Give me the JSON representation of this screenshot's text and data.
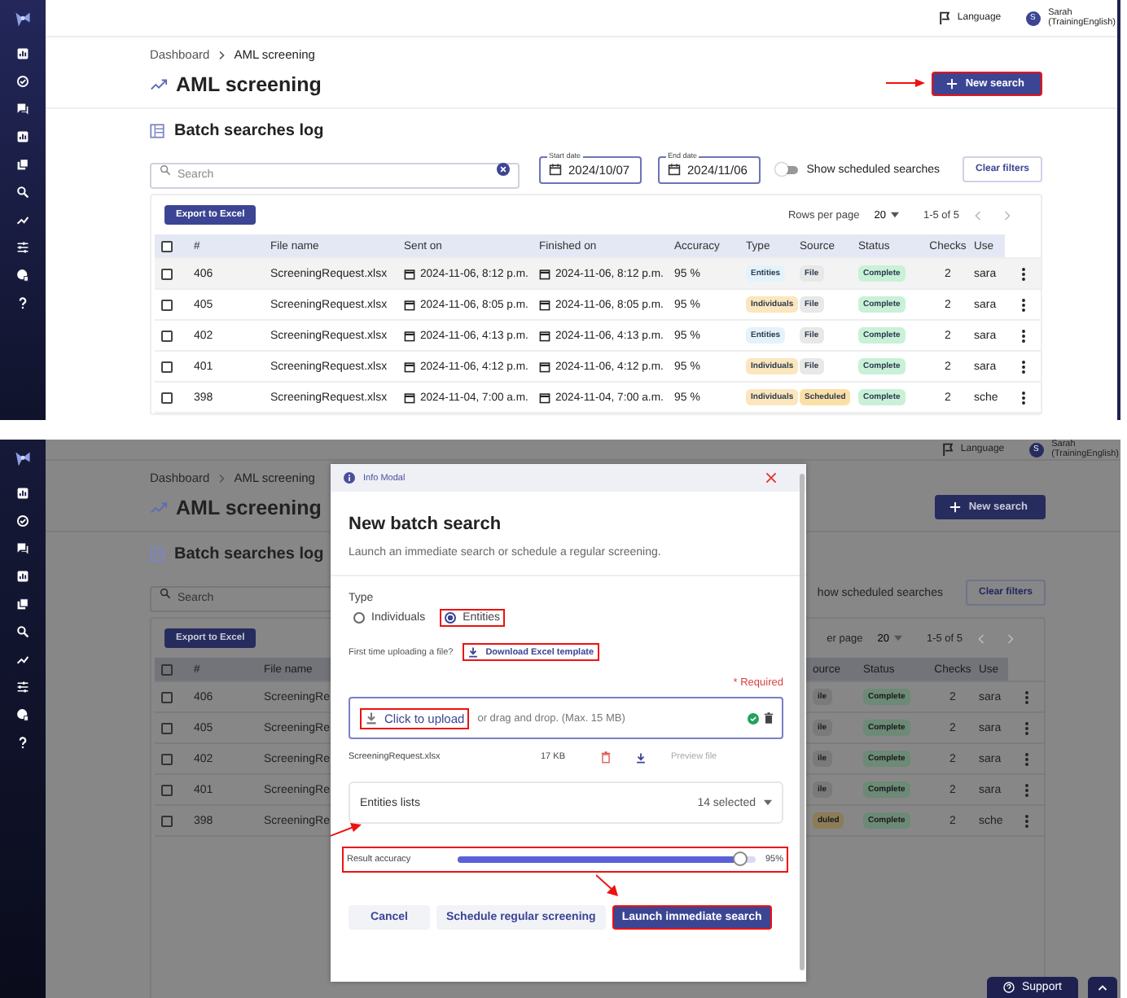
{
  "panels": [
    {
      "header": {
        "language": "Language",
        "avatar_initial": "S",
        "user_name": "Sarah",
        "user_detail": "(TrainingEnglish)"
      },
      "breadcrumb": [
        "Dashboard",
        "AML screening"
      ],
      "title": "AML screening",
      "new_search_button": {
        "label": "New search",
        "highlighted": true,
        "arrow": true
      },
      "section_title": "Batch searches log",
      "search": {
        "placeholder": "Search",
        "clearable": true
      },
      "start_date": {
        "label": "Start date",
        "value": "2024/10/07"
      },
      "end_date": {
        "label": "End date",
        "value": "2024/11/06"
      },
      "scheduled_toggle": {
        "label": "Show scheduled searches",
        "on": false
      },
      "clear_filters": "Clear filters",
      "export_button": "Export to Excel",
      "pagination": {
        "rows_per_page_label": "Rows per page",
        "rows_per_page": "20",
        "range": "1-5 of 5"
      },
      "table": {
        "columns": [
          {
            "kind": "select",
            "checked": false
          },
          {
            "kind": "number",
            "label": "#"
          },
          {
            "kind": "file",
            "label": "File name"
          },
          {
            "kind": "date",
            "label": "Sent on"
          },
          {
            "kind": "date",
            "label": "Finished on"
          },
          {
            "kind": "accuracy",
            "label": "Accuracy"
          },
          {
            "kind": "type",
            "label": "Type"
          },
          {
            "kind": "source",
            "label": "Source"
          },
          {
            "kind": "status",
            "label": "Status"
          },
          {
            "kind": "checks",
            "label": "Checks"
          },
          {
            "kind": "user",
            "label": "Use"
          }
        ],
        "rows": [
          {
            "hovered": true,
            "cells": [
              {
                "checked": false
              },
              "406",
              "ScreeningRequest.xlsx",
              "2024-11-06, 8:12 p.m.",
              "2024-11-06, 8:12 p.m.",
              "95 %",
              {
                "label": "Entities",
                "color": "#e4f3fb"
              },
              {
                "label": "File",
                "color": "#e8e8e8"
              },
              {
                "label": "Complete",
                "color": "#c8f1d8"
              },
              "2",
              "sara"
            ]
          },
          {
            "hovered": false,
            "cells": [
              {
                "checked": false
              },
              "405",
              "ScreeningRequest.xlsx",
              "2024-11-06, 8:05 p.m.",
              "2024-11-06, 8:05 p.m.",
              "95 %",
              {
                "label": "Individuals",
                "color": "#fbe6bd"
              },
              {
                "label": "File",
                "color": "#e8e8e8"
              },
              {
                "label": "Complete",
                "color": "#c8f1d8"
              },
              "2",
              "sara"
            ]
          },
          {
            "hovered": false,
            "cells": [
              {
                "checked": false
              },
              "402",
              "ScreeningRequest.xlsx",
              "2024-11-06, 4:13 p.m.",
              "2024-11-06, 4:13 p.m.",
              "95 %",
              {
                "label": "Entities",
                "color": "#e4f3fb"
              },
              {
                "label": "File",
                "color": "#e8e8e8"
              },
              {
                "label": "Complete",
                "color": "#c8f1d8"
              },
              "2",
              "sara"
            ]
          },
          {
            "hovered": false,
            "cells": [
              {
                "checked": false
              },
              "401",
              "ScreeningRequest.xlsx",
              "2024-11-06, 4:12 p.m.",
              "2024-11-06, 4:12 p.m.",
              "95 %",
              {
                "label": "Individuals",
                "color": "#fbe6bd"
              },
              {
                "label": "File",
                "color": "#e8e8e8"
              },
              {
                "label": "Complete",
                "color": "#c8f1d8"
              },
              "2",
              "sara"
            ]
          },
          {
            "hovered": false,
            "cells": [
              {
                "checked": false
              },
              "398",
              "ScreeningRequest.xlsx",
              "2024-11-04, 7:00 a.m.",
              "2024-11-04, 7:00 a.m.",
              "95 %",
              {
                "label": "Individuals",
                "color": "#fbe6bd"
              },
              {
                "label": "Scheduled",
                "color": "#fbe0a6"
              },
              {
                "label": "Complete",
                "color": "#c8f1d8"
              },
              "2",
              "sche"
            ]
          }
        ]
      }
    },
    {
      "header": {
        "language": "Language",
        "avatar_initial": "S",
        "user_name": "Sarah",
        "user_detail": "(TrainingEnglish)"
      },
      "breadcrumb": [
        "Dashboard",
        "AML screening"
      ],
      "title": "AML screening",
      "new_search_button": {
        "label": "New search",
        "highlighted": false
      },
      "section_title": "Batch searches log",
      "search": {
        "placeholder": "Search"
      },
      "scheduled_toggle": {
        "label": "how scheduled searches"
      },
      "clear_filters": "Clear filters",
      "export_button": "Export to Excel",
      "pagination": {
        "rows_per_page_label": "er page",
        "rows_per_page": "20",
        "range": "1-5 of 5"
      },
      "table": {
        "columns": [
          {
            "kind": "select",
            "checked": false
          },
          {
            "kind": "number",
            "label": "#"
          },
          {
            "kind": "file",
            "label": "File name"
          },
          {
            "kind": "covered"
          },
          {
            "kind": "source",
            "label": "ource"
          },
          {
            "kind": "status",
            "label": "Status"
          },
          {
            "kind": "checks",
            "label": "Checks"
          },
          {
            "kind": "user",
            "label": "Use"
          }
        ],
        "rows": [
          {
            "cells": [
              {
                "checked": false
              },
              "406",
              "ScreeningRe",
              null,
              {
                "label": "ile",
                "color": "#7a7a7a"
              },
              {
                "label": "Complete",
                "color": "#6c8a76"
              },
              "2",
              "sara"
            ]
          },
          {
            "cells": [
              {
                "checked": false
              },
              "405",
              "ScreeningRe",
              null,
              {
                "label": "ile",
                "color": "#7a7a7a"
              },
              {
                "label": "Complete",
                "color": "#6c8a76"
              },
              "2",
              "sara"
            ]
          },
          {
            "cells": [
              {
                "checked": false
              },
              "402",
              "ScreeningRe",
              null,
              {
                "label": "ile",
                "color": "#7a7a7a"
              },
              {
                "label": "Complete",
                "color": "#6c8a76"
              },
              "2",
              "sara"
            ]
          },
          {
            "cells": [
              {
                "checked": false
              },
              "401",
              "ScreeningRe",
              null,
              {
                "label": "ile",
                "color": "#7a7a7a"
              },
              {
                "label": "Complete",
                "color": "#6c8a76"
              },
              "2",
              "sara"
            ]
          },
          {
            "cells": [
              {
                "checked": false
              },
              "398",
              "ScreeningRe",
              null,
              {
                "label": "duled",
                "color": "#8c7c58"
              },
              {
                "label": "Complete",
                "color": "#6c8a76"
              },
              "2",
              "sche"
            ]
          }
        ]
      },
      "modal": {
        "header": "Info Modal",
        "title": "New batch search",
        "subtitle": "Launch an immediate search or schedule a regular screening.",
        "type_label": "Type",
        "type_options": [
          {
            "label": "Individuals",
            "selected": false,
            "highlighted": false
          },
          {
            "label": "Entities",
            "selected": true,
            "highlighted": true
          }
        ],
        "template_prompt": "First time uploading a file?",
        "template_link": {
          "label": "Download Excel template",
          "highlighted": true
        },
        "required_note": "* Required",
        "upload": {
          "link": "Click to upload",
          "link_highlighted": true,
          "hint": "or drag and drop. (Max. 15 MB)",
          "uploaded": true
        },
        "file": {
          "name": "ScreeningRequest.xlsx",
          "size": "17 KB",
          "preview": "Preview file"
        },
        "lists_select": {
          "label": "Entities lists",
          "value": "14 selected",
          "arrow": true
        },
        "accuracy": {
          "label": "Result accuracy",
          "level": 0.95,
          "reading": "95%",
          "highlighted": true
        },
        "buttons": [
          {
            "label": "Cancel",
            "kind": "plain",
            "highlighted": false,
            "arrow": false
          },
          {
            "label": "Schedule regular screening",
            "kind": "secondary",
            "highlighted": false,
            "arrow": false
          },
          {
            "label": "Launch immediate search",
            "kind": "primary",
            "highlighted": true,
            "arrow": true
          }
        ]
      },
      "support_button": "Support"
    }
  ]
}
